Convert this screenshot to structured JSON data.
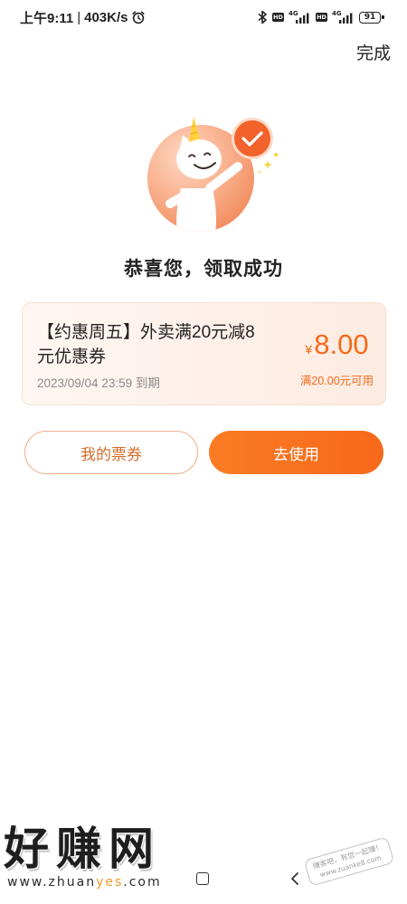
{
  "status_bar": {
    "time": "上午9:11",
    "separator": "|",
    "speed": "403K/s",
    "icons": {
      "alarm": "alarm-clock-icon",
      "bluetooth": "bluetooth-icon",
      "signal": "signal-bars-icon",
      "battery": "battery-icon"
    },
    "sim1": {
      "badge": "HD",
      "network": "4G"
    },
    "sim2": {
      "badge": "HD",
      "network": "4G"
    },
    "battery_level": "91"
  },
  "header": {
    "done_label": "完成"
  },
  "success": {
    "illustration": "unicorn-mascot",
    "badge_icon": "check-icon",
    "title": "恭喜您，领取成功"
  },
  "coupon": {
    "name": "【约惠周五】外卖满20元减8元优惠券",
    "expiry": "2023/09/04 23:59 到期",
    "currency_symbol": "¥",
    "amount": "8.00",
    "condition": "满20.00元可用"
  },
  "actions": {
    "my_tickets_label": "我的票券",
    "use_label": "去使用"
  },
  "watermark": {
    "site_name": "好赚网",
    "url": "www.zhuanyes.com",
    "url_highlight": "yes"
  },
  "stamp": {
    "line1": "赚客吧，有您一起赚！",
    "line2": "www.zuanke8.com"
  },
  "nav_bar": {
    "home_icon": "square-home-icon",
    "back_icon": "chevron-left-icon"
  },
  "colors": {
    "accent": "#f7691b",
    "accent_text": "#d56c2b",
    "accent_border": "#ecb08a",
    "circle_light": "#fed9c3",
    "circle_dark": "#f3895a",
    "badge": "#f2622b",
    "title_text": "#222222",
    "muted_text": "#8a8a8a",
    "card_bg_left": "#fff7f2",
    "card_bg_right": "#fdebe1",
    "card_border": "#f6e0d3",
    "url_highlight": "#f2982a"
  }
}
